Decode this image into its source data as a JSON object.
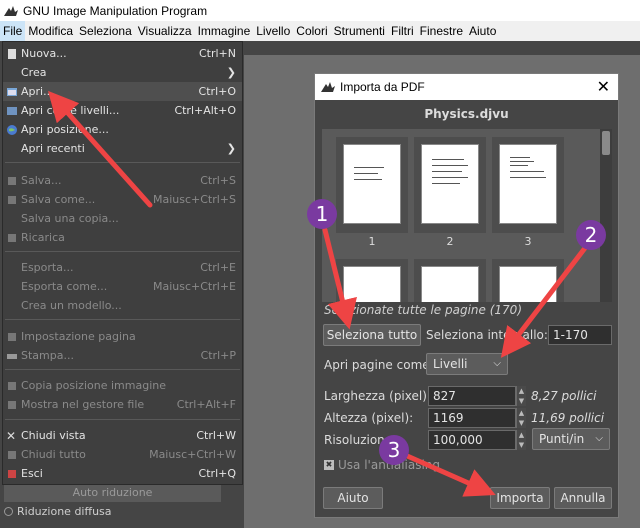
{
  "window": {
    "title": "GNU Image Manipulation Program"
  },
  "menubar": {
    "items": [
      "File",
      "Modifica",
      "Seleziona",
      "Visualizza",
      "Immagine",
      "Livello",
      "Colori",
      "Strumenti",
      "Filtri",
      "Finestre",
      "Aiuto"
    ]
  },
  "file_menu": {
    "items": [
      {
        "label": "Nuova...",
        "shortcut": "Ctrl+N",
        "icon": "new-document-icon"
      },
      {
        "label": "Crea",
        "shortcut": "",
        "submenu": true
      },
      {
        "label": "Apri...",
        "shortcut": "Ctrl+O",
        "icon": "open-icon"
      },
      {
        "label": "Apri come livelli...",
        "shortcut": "Ctrl+Alt+O",
        "icon": "open-layers-icon"
      },
      {
        "label": "Apri posizione...",
        "shortcut": "",
        "icon": "globe-icon"
      },
      {
        "label": "Apri recenti",
        "shortcut": "",
        "submenu": true
      },
      {
        "label": "Salva...",
        "shortcut": "Ctrl+S"
      },
      {
        "label": "Salva come...",
        "shortcut": "Maiusc+Ctrl+S"
      },
      {
        "label": "Salva una copia...",
        "shortcut": ""
      },
      {
        "label": "Ricarica",
        "shortcut": ""
      },
      {
        "label": "Esporta...",
        "shortcut": "Ctrl+E"
      },
      {
        "label": "Esporta come...",
        "shortcut": "Maiusc+Ctrl+E"
      },
      {
        "label": "Crea un modello...",
        "shortcut": ""
      },
      {
        "label": "Impostazione pagina",
        "shortcut": ""
      },
      {
        "label": "Stampa...",
        "shortcut": "Ctrl+P"
      },
      {
        "label": "Copia posizione immagine",
        "shortcut": ""
      },
      {
        "label": "Mostra nel gestore file",
        "shortcut": "Ctrl+Alt+F"
      },
      {
        "label": "Chiudi vista",
        "shortcut": "Ctrl+W"
      },
      {
        "label": "Chiudi tutto",
        "shortcut": "Maiusc+Ctrl+W"
      },
      {
        "label": "Esci",
        "shortcut": "Ctrl+Q"
      }
    ]
  },
  "tool_options": {
    "auto_button": "Auto riduzione",
    "radio_label": "Riduzione diffusa"
  },
  "dialog": {
    "title": "Importa da PDF",
    "filename": "Physics.djvu",
    "thumbnails": [
      "1",
      "2",
      "3"
    ],
    "selected_caption": "Selezionate tutte le pagine (170)",
    "select_all_button": "Seleziona tutto",
    "select_range_label": "Seleziona intervallo:",
    "range_value": "1-170",
    "open_pages_as_label": "Apri pagine come",
    "open_pages_as_value": "Livelli",
    "width_label": "Larghezza (pixel):",
    "width_value": "827",
    "width_inches": "8,27 pollici",
    "height_label": "Altezza (pixel):",
    "height_value": "1169",
    "height_inches": "11,69 pollici",
    "resolution_label": "Risoluzione:",
    "resolution_value": "100,000",
    "resolution_unit": "Punti/in",
    "antialias_label": "Usa l'antialiasing",
    "help_button": "Aiuto",
    "import_button": "Importa",
    "cancel_button": "Annulla"
  },
  "annotations": {
    "badges": [
      "1",
      "2",
      "3"
    ],
    "arrow_color": "#ee4444",
    "badge_color": "#7a3aa0"
  }
}
